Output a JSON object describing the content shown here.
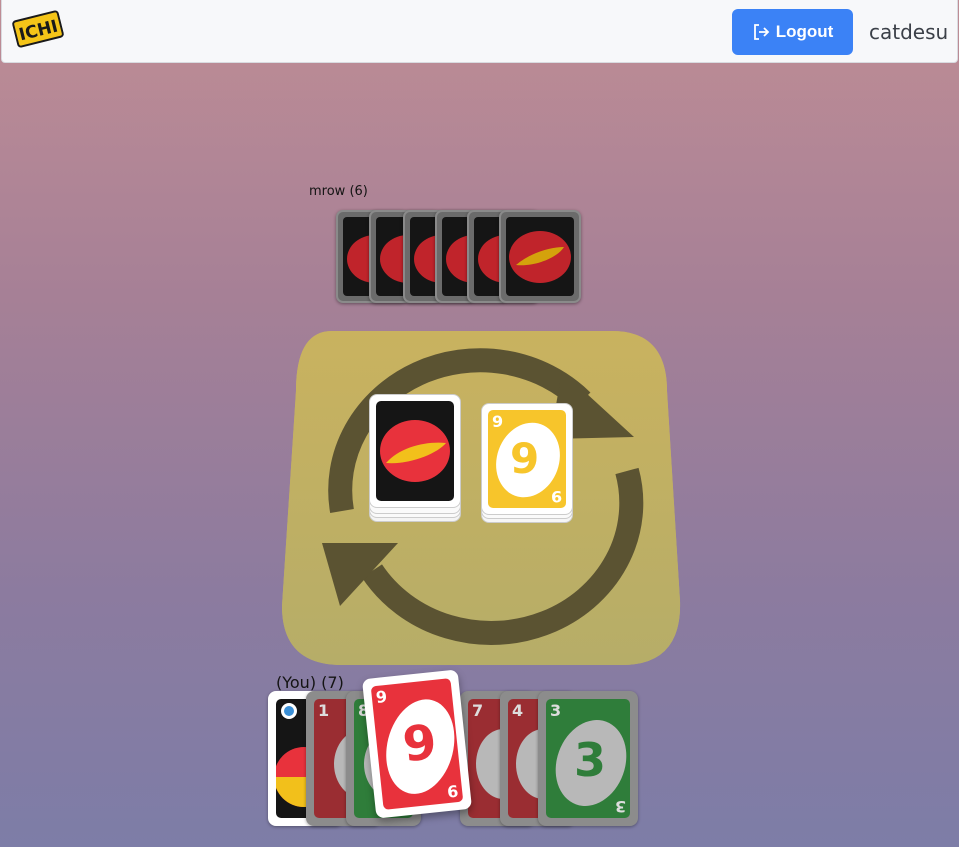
{
  "navbar": {
    "logo_text": "ICHI",
    "logout_label": "Logout",
    "username": "catdesu"
  },
  "opponent": {
    "label": "mrow (6)",
    "card_count": 6
  },
  "player": {
    "label": "(You) (7)",
    "hand": [
      {
        "type": "wild",
        "color": "black"
      },
      {
        "value": "1",
        "color": "red"
      },
      {
        "value": "8",
        "color": "green"
      },
      {
        "value": "9",
        "color": "red",
        "selected": true
      },
      {
        "value": "7",
        "color": "red"
      },
      {
        "value": "4",
        "color": "red"
      },
      {
        "value": "3",
        "color": "green"
      }
    ]
  },
  "table": {
    "draw_pile": "card-back",
    "discard_top": {
      "value": "9",
      "color": "yellow"
    },
    "direction": "clockwise"
  },
  "colors": {
    "red": "#e8323c",
    "green": "#2f7d3a",
    "yellow": "#f7c52b",
    "board": "#c6b062",
    "accent": "#3b82f6"
  }
}
